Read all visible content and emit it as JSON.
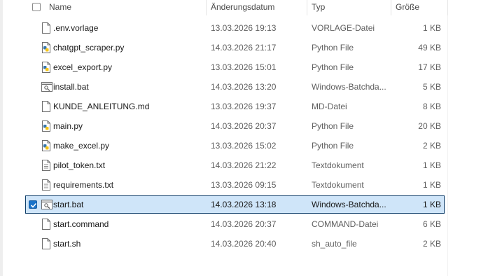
{
  "header": {
    "name": "Name",
    "date": "Änderungsdatum",
    "type": "Typ",
    "size": "Größe"
  },
  "files": [
    {
      "name": ".env.vorlage",
      "date": "13.03.2026 19:13",
      "type": "VORLAGE-Datei",
      "size": "1 KB",
      "icon": "generic-file-icon",
      "selected": false
    },
    {
      "name": "chatgpt_scraper.py",
      "date": "14.03.2026 21:17",
      "type": "Python File",
      "size": "49 KB",
      "icon": "python-file-icon",
      "selected": false
    },
    {
      "name": "excel_export.py",
      "date": "13.03.2026 15:01",
      "type": "Python File",
      "size": "17 KB",
      "icon": "python-file-icon",
      "selected": false
    },
    {
      "name": "install.bat",
      "date": "14.03.2026 13:20",
      "type": "Windows-Batchda...",
      "size": "5 KB",
      "icon": "batch-file-icon",
      "selected": false
    },
    {
      "name": "KUNDE_ANLEITUNG.md",
      "date": "13.03.2026 19:37",
      "type": "MD-Datei",
      "size": "8 KB",
      "icon": "generic-file-icon",
      "selected": false
    },
    {
      "name": "main.py",
      "date": "14.03.2026 20:37",
      "type": "Python File",
      "size": "20 KB",
      "icon": "python-file-icon",
      "selected": false
    },
    {
      "name": "make_excel.py",
      "date": "13.03.2026 15:02",
      "type": "Python File",
      "size": "2 KB",
      "icon": "python-file-icon",
      "selected": false
    },
    {
      "name": "pilot_token.txt",
      "date": "14.03.2026 21:22",
      "type": "Textdokument",
      "size": "1 KB",
      "icon": "text-file-icon",
      "selected": false
    },
    {
      "name": "requirements.txt",
      "date": "13.03.2026 09:15",
      "type": "Textdokument",
      "size": "1 KB",
      "icon": "text-file-icon",
      "selected": false
    },
    {
      "name": "start.bat",
      "date": "14.03.2026 13:18",
      "type": "Windows-Batchda...",
      "size": "1 KB",
      "icon": "batch-file-icon",
      "selected": true
    },
    {
      "name": "start.command",
      "date": "14.03.2026 20:37",
      "type": "COMMAND-Datei",
      "size": "6 KB",
      "icon": "generic-file-icon",
      "selected": false
    },
    {
      "name": "start.sh",
      "date": "14.03.2026 20:40",
      "type": "sh_auto_file",
      "size": "2 KB",
      "icon": "generic-file-icon",
      "selected": false
    }
  ],
  "colors": {
    "selection_bg": "#cfe5f9",
    "selection_border": "#0f3e6b",
    "checkbox_checked": "#1a73c9"
  }
}
